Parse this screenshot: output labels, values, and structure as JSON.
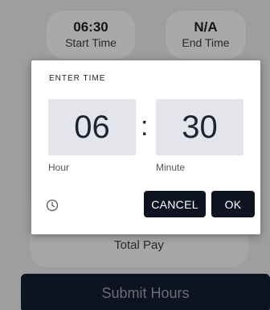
{
  "background": {
    "start": {
      "value": "06:30",
      "label": "Start Time"
    },
    "end": {
      "value": "N/A",
      "label": "End Time"
    },
    "pay": {
      "label": "Total Pay"
    },
    "submit_label": "Submit Hours"
  },
  "dialog": {
    "title": "ENTER TIME",
    "hour": "06",
    "separator": ":",
    "minute": "30",
    "hour_label": "Hour",
    "minute_label": "Minute",
    "cancel_label": "CANCEL",
    "ok_label": "OK",
    "mode_icon": "clock-icon"
  },
  "colors": {
    "primary": "#0d1321",
    "field_bg": "#e4e5ea",
    "scrim": "#9e9e9e"
  }
}
